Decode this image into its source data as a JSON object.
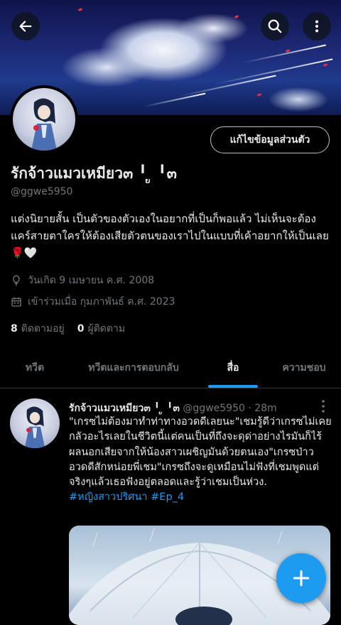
{
  "header": {
    "back_icon": "arrow-left-icon",
    "search_icon": "search-icon",
    "more_icon": "more-vertical-icon"
  },
  "profile": {
    "edit_button_label": "แก้ไขข้อมูลส่วนตัว",
    "name": "รักจ้าวแมวเหมียว๓ ╹ ູ ╹๓",
    "handle": "@ggwe5950",
    "bio": "แต่งนิยายสั้น เป็นตัวของตัวเองในอยากที่เป็นก็พอแล้ว ไม่เห็นจะต้องแคร์สายตาใครให้ต้องเสียตัวตนของเราไปในแบบที่เค้าอยากให้เป็นเลย🌹🤍",
    "birthday": "วันเกิด 9 เมษายน ค.ศ. 2008",
    "joined": "เข้าร่วมเมื่อ กุมภาพันธ์ ค.ศ. 2023",
    "following_count": "8",
    "following_label": "ติดตามอยู่",
    "followers_count": "0",
    "followers_label": "ผู้ติดตาม"
  },
  "tabs": [
    {
      "label": "ทวีต",
      "active": false
    },
    {
      "label": "ทวีตและการตอบกลับ",
      "active": false
    },
    {
      "label": "สื่อ",
      "active": true
    },
    {
      "label": "ความชอบ",
      "active": false
    }
  ],
  "tweet": {
    "name": "รักจ้าวแมวเหมียว๓ ╹ ູ ╹๓",
    "handle_time": "@ggwe5950 · 28m",
    "text": "\"เกรซไม่ต้องมาทำท่าทางอวดดีเลยนะ\"เชมรู้ดีว่าเกรซไม่เคยกลัวอะไรเลยในชีวิตนี้แต่คนเป็นที่ถึงจะดุด่าอย่างไรมันก็ไร้ผลนอกเสียจากให้น้องสาวเผชิญมันด้วยตนเอง\"เกรซป่าวอวดดีสักหน่อยพี่เชม\"เกรซถึงจะดูเหมือนไม่ฟังที่เชมพูดแต่จริงๆแล้วเธอฟังอยู่ตลอดและรู้ว่าเชมเป็นห่วง.",
    "hashtags": "#หญิงสาวปริศนา #Ep_4"
  },
  "fab_icon": "plus-icon",
  "colors": {
    "accent": "#1d9bf0",
    "background": "#000000",
    "text": "#e7e9ea",
    "secondary_text": "#71767b"
  }
}
